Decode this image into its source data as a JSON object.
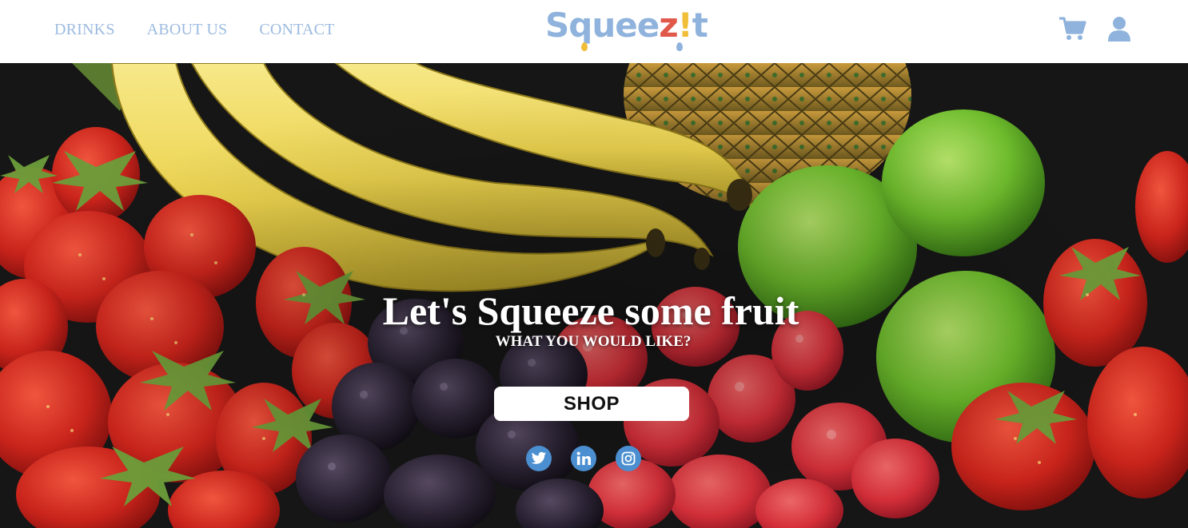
{
  "nav": {
    "links": [
      {
        "label": "DRINKS"
      },
      {
        "label": "ABOUT US"
      },
      {
        "label": "CONTACT"
      }
    ],
    "logo": {
      "part1": "Squee",
      "part2": "z",
      "part3": "!",
      "part4": "t"
    },
    "icons": [
      "cart-icon",
      "user-icon"
    ]
  },
  "hero": {
    "title": "Let's Squeeze some fruit",
    "subtitle": "WHAT YOU WOULD LIKE?",
    "cta_label": "SHOP",
    "socials": [
      "twitter-icon",
      "linkedin-icon",
      "instagram-icon"
    ]
  },
  "colors": {
    "nav_text": "#9cbbe0",
    "logo_blue": "#8fb3dc",
    "logo_red": "#e0584a",
    "logo_yellow": "#f1be3a",
    "social_blue": "#4b8fd0"
  }
}
